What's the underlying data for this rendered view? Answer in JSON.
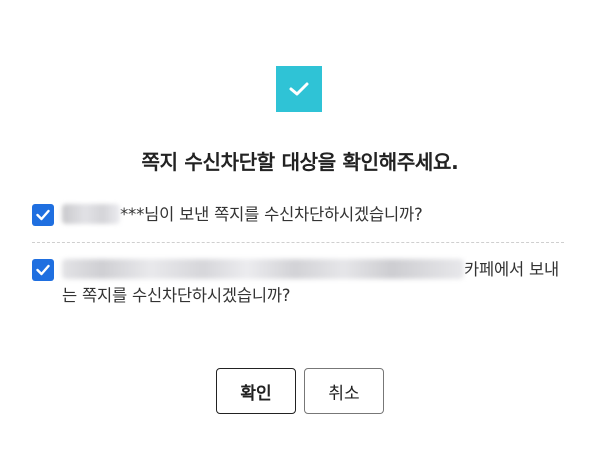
{
  "dialog": {
    "title": "쪽지 수신차단할 대상을 확인해주세요.",
    "accent_color": "#2fc3d6",
    "checkbox_color": "#1f6fe0",
    "icon": "check-icon"
  },
  "items": [
    {
      "checked": true,
      "masked_suffix": "***",
      "text": "님이 보낸 쪽지를 수신차단하시겠습니까?"
    },
    {
      "checked": true,
      "text": "카페에서 보내는 쪽지를 수신차단하시겠습니까?"
    }
  ],
  "buttons": {
    "confirm_label": "확인",
    "cancel_label": "취소"
  }
}
